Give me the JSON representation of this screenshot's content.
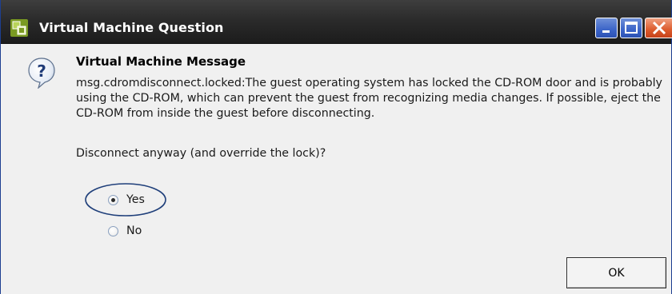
{
  "window": {
    "title": "Virtual Machine Question",
    "app_icon": "vmware-app-icon",
    "controls": {
      "minimize": "minimize-icon",
      "maximize": "maximize-icon",
      "close": "close-icon"
    }
  },
  "message": {
    "icon": "question-icon",
    "heading": "Virtual Machine Message",
    "body": "msg.cdromdisconnect.locked:The guest operating system has locked the CD-ROM door and is probably using the CD-ROM, which can prevent the guest from recognizing media changes. If possible, eject the CD-ROM from inside the guest before disconnecting."
  },
  "prompt": "Disconnect anyway (and override the lock)?",
  "options": [
    {
      "label": "Yes",
      "selected": true
    },
    {
      "label": "No",
      "selected": false
    }
  ],
  "ok_label": "OK",
  "colors": {
    "titlebar": "#2b2b2b",
    "highlight_ellipse": "#1f3f7a",
    "close_button": "#dc5b2c",
    "window_buttons": "#3b64c8"
  }
}
